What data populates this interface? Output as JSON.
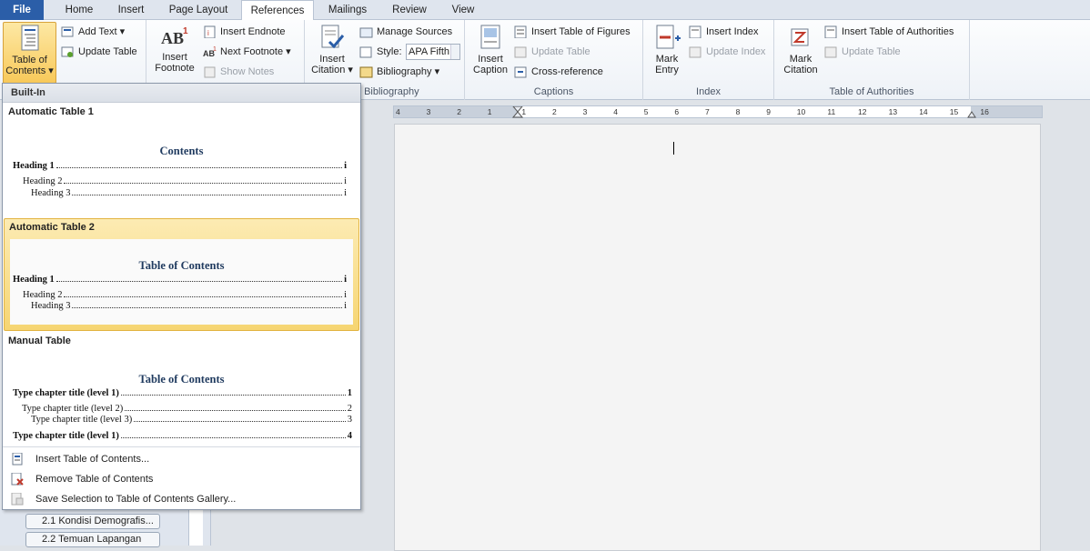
{
  "tabs": [
    "File",
    "Home",
    "Insert",
    "Page Layout",
    "References",
    "Mailings",
    "Review",
    "View"
  ],
  "ribbon": {
    "toc_btn": {
      "label1": "Table of",
      "label2": "Contents ▾"
    },
    "add_text": "Add Text ▾",
    "update_table": "Update Table",
    "insert_footnote": {
      "label1": "Insert",
      "label2": "Footnote"
    },
    "insert_endnote": "Insert Endnote",
    "next_footnote": "Next Footnote ▾",
    "show_notes": "Show Notes",
    "insert_citation": {
      "label1": "Insert",
      "label2": "Citation ▾"
    },
    "manage_sources": "Manage Sources",
    "style_label": "Style:",
    "style_value": "APA Fifth",
    "bibliography": "Bibliography ▾",
    "citations_group": "ns & Bibliography",
    "insert_caption": {
      "label1": "Insert",
      "label2": "Caption"
    },
    "insert_tof": "Insert Table of Figures",
    "update_table_cap": "Update Table",
    "cross_reference": "Cross-reference",
    "captions_group": "Captions",
    "mark_entry": {
      "label1": "Mark",
      "label2": "Entry"
    },
    "insert_index": "Insert Index",
    "update_index": "Update Index",
    "index_group": "Index",
    "mark_citation": {
      "label1": "Mark",
      "label2": "Citation"
    },
    "insert_toa": "Insert Table of Authorities",
    "update_table_toa": "Update Table",
    "toa_group": "Table of Authorities"
  },
  "dropdown": {
    "header": "Built-In",
    "auto1": {
      "name": "Automatic Table 1",
      "title": "Contents",
      "h1": "Heading 1",
      "h2": "Heading 2",
      "h3": "Heading 3",
      "page": "i"
    },
    "auto2": {
      "name": "Automatic Table 2",
      "title": "Table of Contents",
      "h1": "Heading 1",
      "h2": "Heading 2",
      "h3": "Heading 3",
      "page": "i"
    },
    "manual": {
      "name": "Manual Table",
      "title": "Table of Contents",
      "l1": "Type chapter title (level 1)",
      "l2": "Type chapter title (level 2)",
      "l3": "Type chapter title (level 3)",
      "l4": "Type chapter title (level 1)",
      "p1": "1",
      "p2": "2",
      "p3": "3",
      "p4": "4"
    },
    "insert_toc": "Insert Table of Contents...",
    "remove_toc": "Remove Table of Contents",
    "save_selection": "Save Selection to Table of Contents Gallery..."
  },
  "nav": {
    "item1": "2.1 Kondisi Demografis...",
    "item2": "2.2 Temuan Lapangan"
  },
  "ruler": {
    "numbers": [
      "4",
      "3",
      "2",
      "1",
      "1",
      "2",
      "3",
      "4",
      "5",
      "6",
      "7",
      "8",
      "9",
      "10",
      "11",
      "12",
      "13",
      "14",
      "15",
      "16"
    ]
  },
  "colors": {
    "file_tab": "#2b5ea8",
    "selection": "#f6d572",
    "toc_title": "#1f3a5f"
  }
}
